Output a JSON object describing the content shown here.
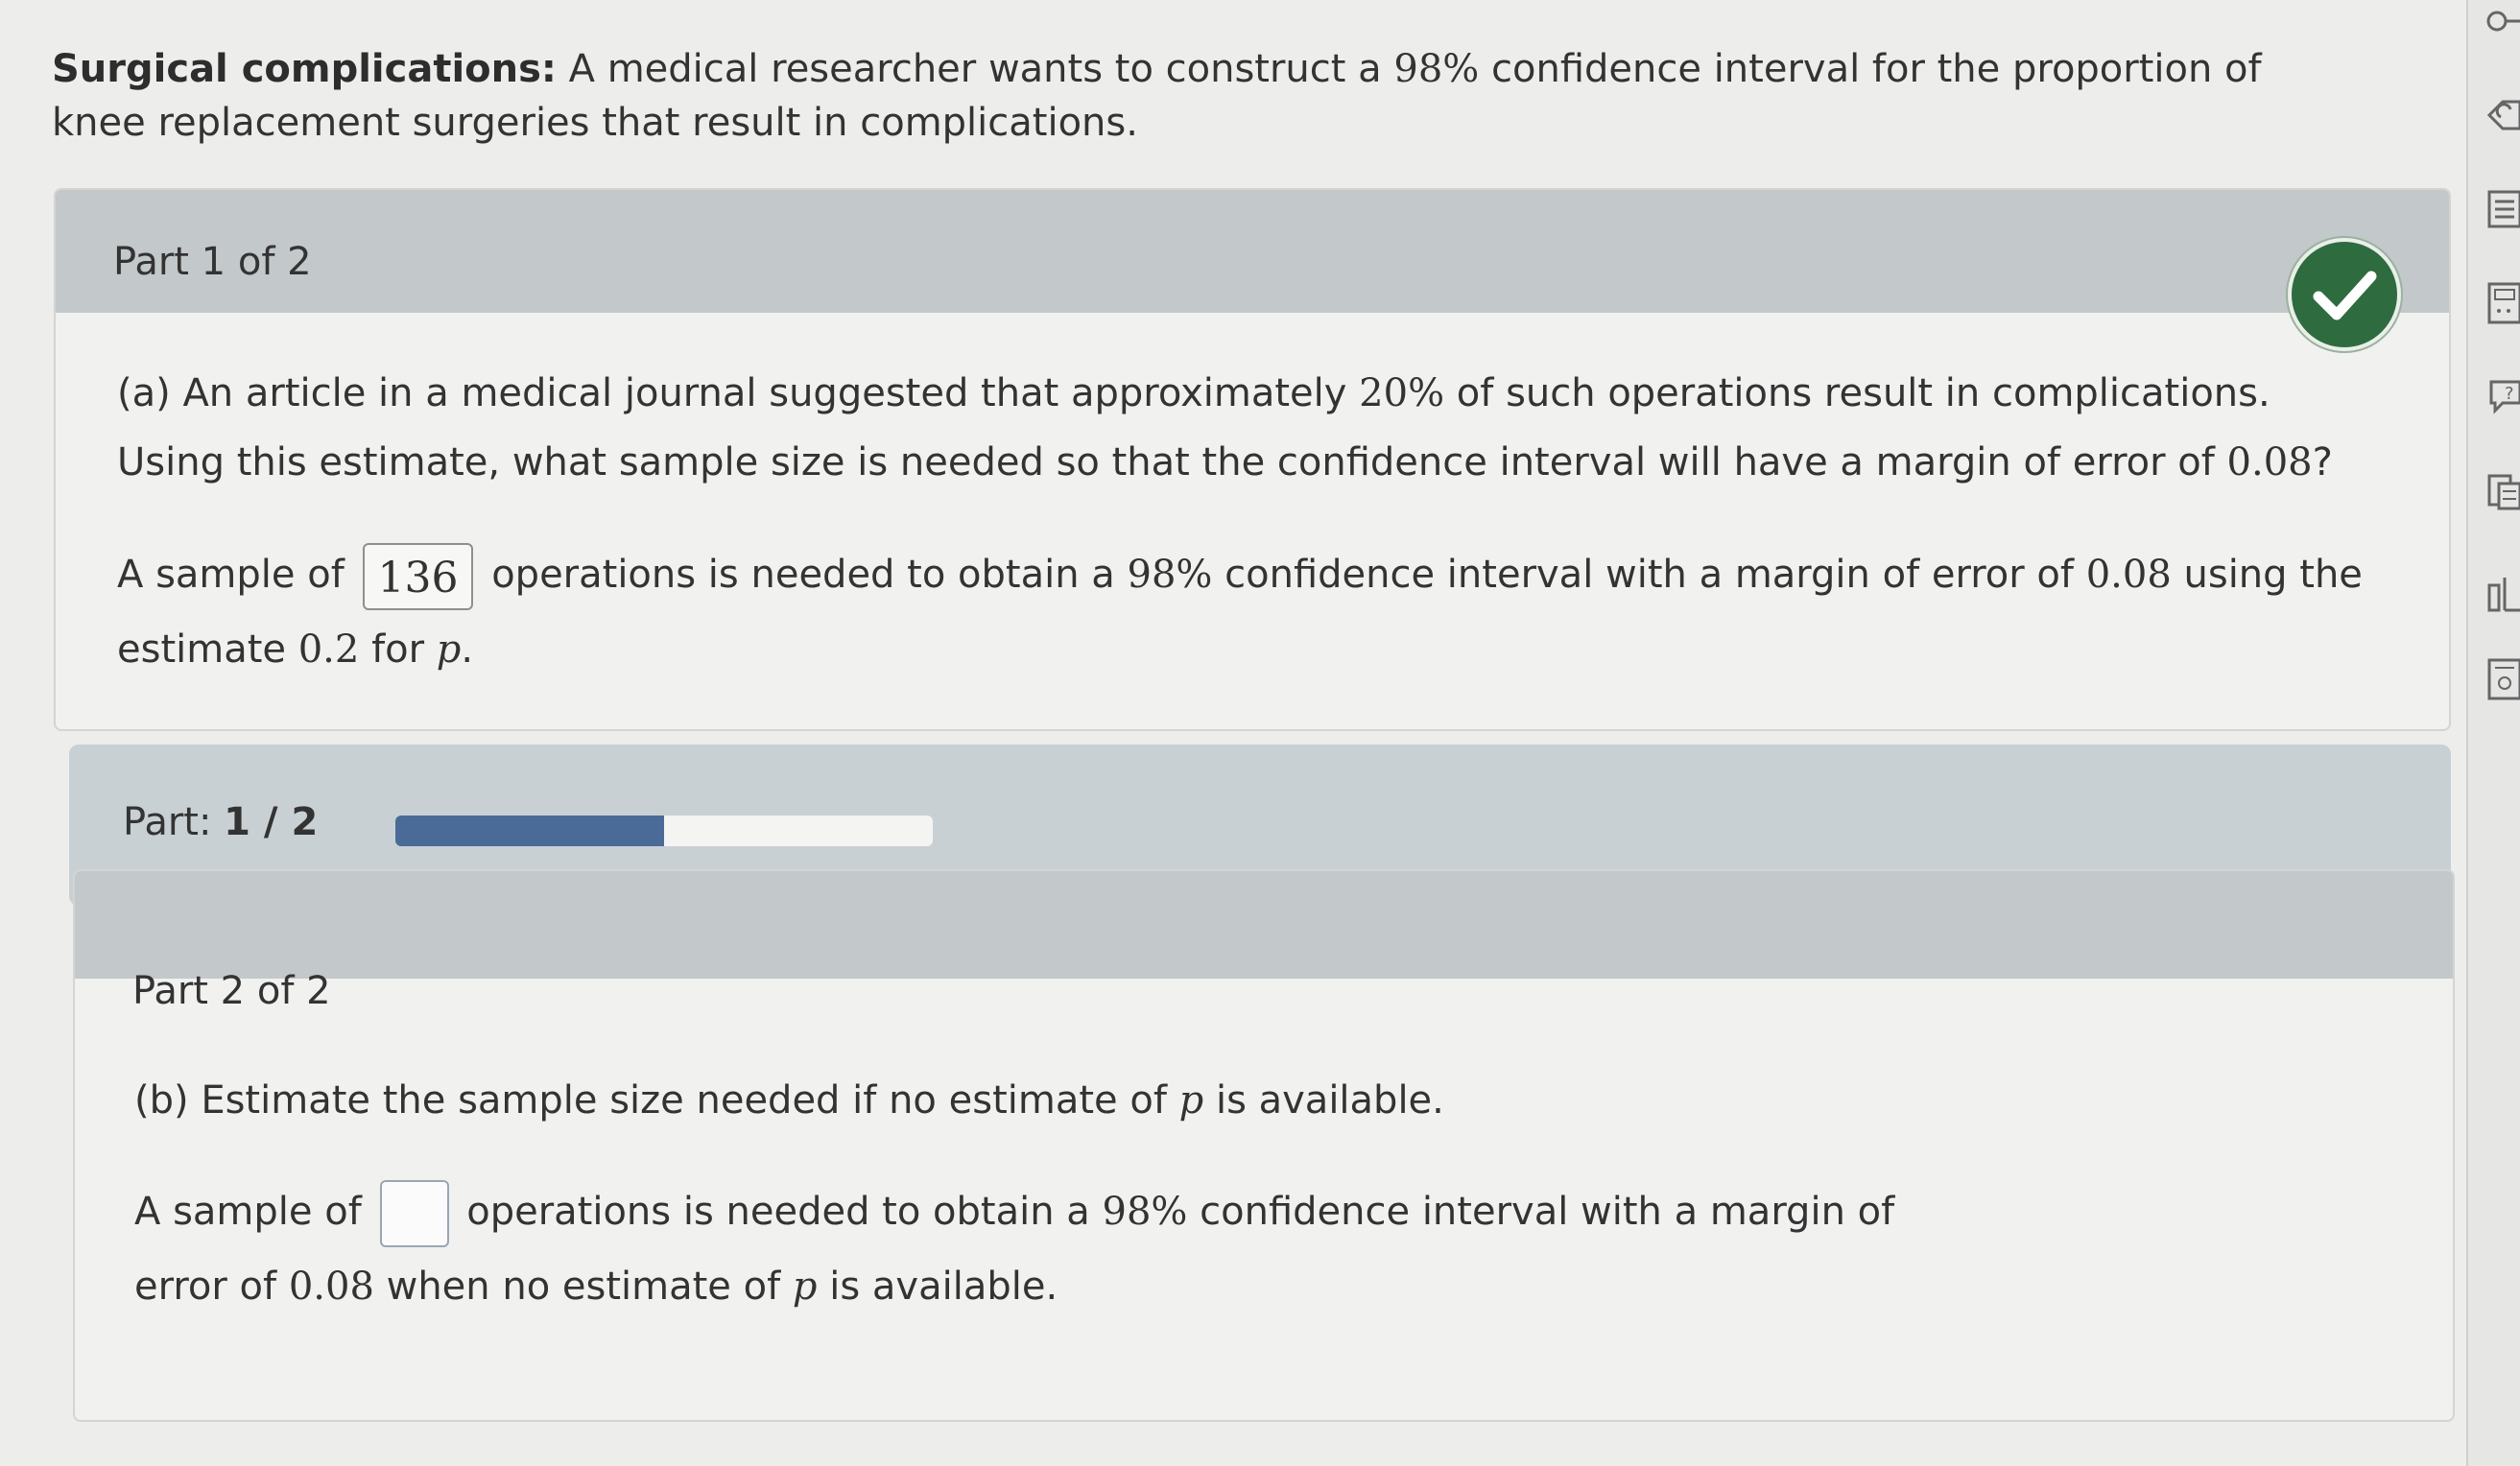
{
  "intro": {
    "heading": "Surgical complications:",
    "text_1": "A medical researcher wants to construct a",
    "confidence": "98%",
    "text_2": "confidence interval for the proportion of knee replacement surgeries that result in complications."
  },
  "part1": {
    "header": "Part 1 of 2",
    "status": "correct",
    "question": {
      "prefix": "(a) An article in a medical journal suggested that approximately",
      "percent": "20%",
      "middle": "of such operations result in complications. Using this estimate, what sample size is needed so that the confidence interval will have a margin of error of",
      "margin": "0.08",
      "suffix": "?"
    },
    "answer": {
      "prefix": "A sample of",
      "value": "136",
      "middle": "operations is needed to obtain a",
      "confidence": "98%",
      "middle2": "confidence interval with a margin of error of",
      "margin": "0.08",
      "middle3": "using the estimate",
      "estimate": "0.2",
      "middle4": "for",
      "variable": "p",
      "suffix": "."
    }
  },
  "progress": {
    "label": "Part:",
    "current": "1 / 2",
    "fraction": 0.5
  },
  "part2": {
    "header": "Part 2 of 2",
    "question": {
      "prefix": "(b) Estimate the sample size needed if no estimate of",
      "variable": "p",
      "suffix": "is available."
    },
    "answer": {
      "prefix": "A sample of",
      "value": "",
      "middle": "operations is needed to obtain a",
      "confidence": "98%",
      "middle2": "confidence interval with a margin of error of",
      "margin": "0.08",
      "middle3": "when no estimate of",
      "variable": "p",
      "suffix": "is available."
    }
  },
  "colors": {
    "header_band": "#c3c8ca",
    "progress_fill": "#4a6a98",
    "check_green": "#2e6b3e"
  },
  "sidebar_icons": [
    "key-icon",
    "redo-icon",
    "list-icon",
    "calculator-icon",
    "help-icon",
    "notes-icon",
    "chart-icon",
    "document-icon"
  ]
}
